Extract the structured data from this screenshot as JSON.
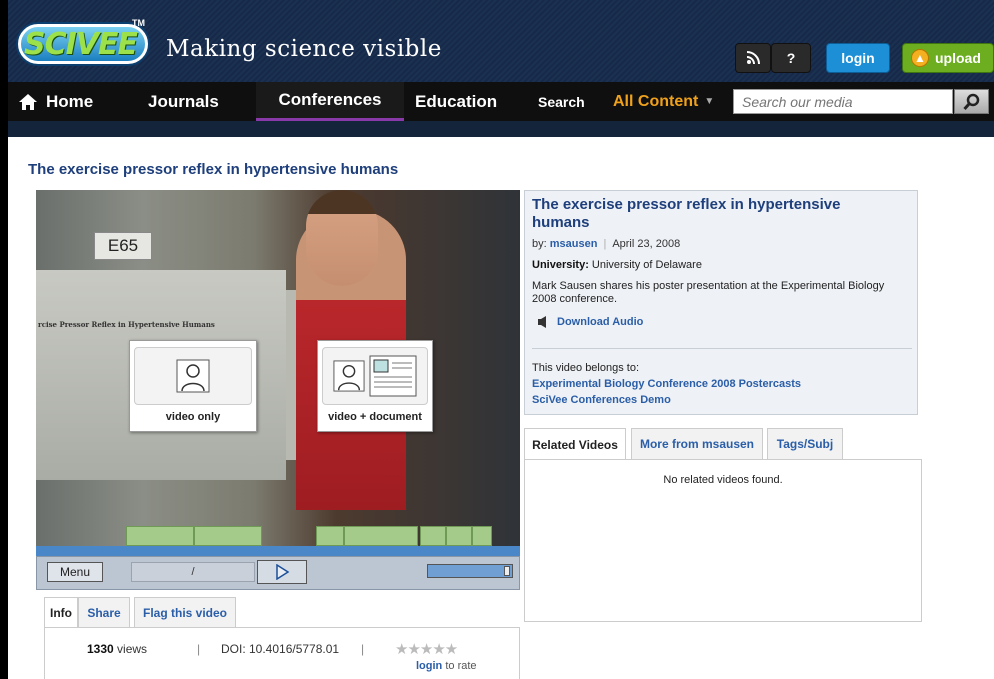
{
  "header": {
    "logo_text": "SCIVEE",
    "logo_tm": "TM",
    "tagline": "Making science visible",
    "rss_label": "⟟",
    "help_label": "?",
    "login_label": "login",
    "upload_label": "upload"
  },
  "nav": {
    "home": "Home",
    "journals": "Journals",
    "conferences": "Conferences",
    "education": "Education",
    "search_label": "Search",
    "all_content": "All Content",
    "search_placeholder": "Search our media"
  },
  "page": {
    "title": "The exercise pressor reflex in hypertensive humans"
  },
  "video": {
    "sign_text": "E65",
    "poster_title": "rcise Pressor Reflex in Hypertensive Humans",
    "option_video_only": "video only",
    "option_video_document": "video + document",
    "menu_label": "Menu",
    "time_text": "/"
  },
  "info_tabs": {
    "info": "Info",
    "share": "Share",
    "flag": "Flag this video"
  },
  "stats": {
    "views_count": "1330",
    "views_label": "views",
    "doi": "DOI: 10.4016/5778.01",
    "rating_stars": "★★★★★",
    "login_link": "login",
    "to_rate": " to rate"
  },
  "details": {
    "title": "The exercise pressor reflex in hypertensive humans",
    "by_label": "by:",
    "author": "msausen",
    "date": "April 23, 2008",
    "university_label": "University:",
    "university": "University of Delaware",
    "description": "Mark Sausen shares his poster presentation at the Experimental Biology 2008 conference.",
    "download_audio": "Download Audio",
    "belongs_label": "This video belongs to:",
    "belongs_1": "Experimental Biology Conference 2008 Postercasts",
    "belongs_2": "SciVee Conferences Demo"
  },
  "related": {
    "tab_related": "Related Videos",
    "tab_more": "More from msausen",
    "tab_tags": "Tags/Subj",
    "empty_text": "No related videos found."
  },
  "colors": {
    "header_bg": "#13243b",
    "nav_bg": "#0f0f0f",
    "link_blue": "#2a5ea8",
    "title_blue": "#1e3f7c",
    "accent_orange": "#f0a11c",
    "login_blue": "#1d8fd6",
    "upload_green": "#6cae1f"
  }
}
